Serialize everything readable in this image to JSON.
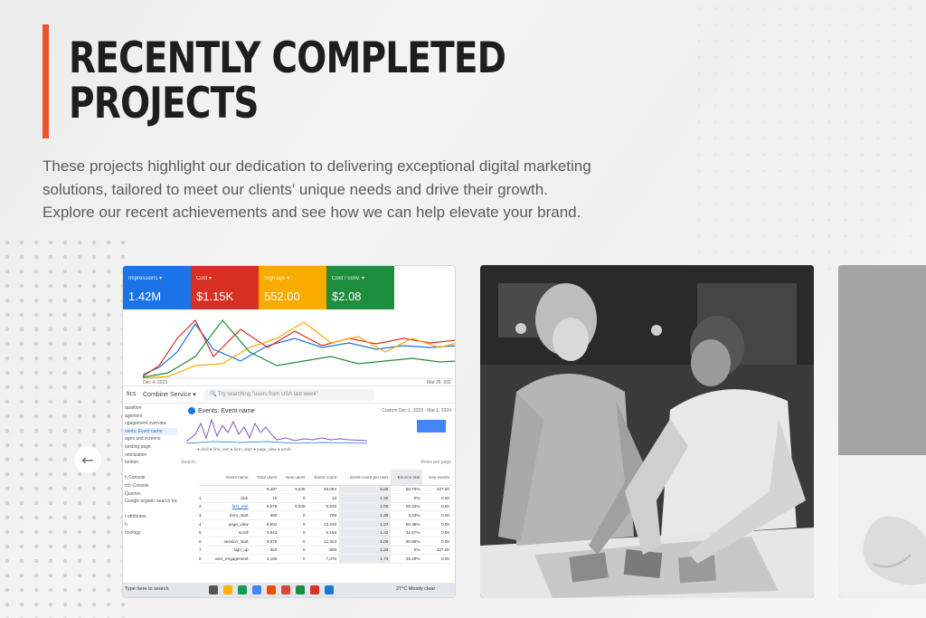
{
  "section": {
    "title_line1": "RECENTLY COMPLETED",
    "title_line2": "PROJECTS",
    "intro_line1": "These projects highlight our dedication to delivering exceptional digital marketing",
    "intro_line2": "solutions, tailored to meet our clients' unique needs and drive their growth.",
    "intro_line3": "Explore our recent achievements and see how we can help elevate your brand."
  },
  "colors": {
    "accent": "#e8542c",
    "heading": "#1e1e1e",
    "body_text": "#5a5a5a"
  },
  "carousel": {
    "prev_icon": "arrow-left-icon"
  },
  "dashboard": {
    "kpis": [
      {
        "label": "Impressions ▾",
        "value": "1.42M",
        "color": "#1a73e8"
      },
      {
        "label": "Cost ▾",
        "value": "$1.15K",
        "color": "#d93025"
      },
      {
        "label": "Sign-ups ▾",
        "value": "552.00",
        "color": "#f9ab00"
      },
      {
        "label": "Cost / conv. ▾",
        "value": "$2.08",
        "color": "#1e8e3e"
      }
    ],
    "chart_start": "Dec 4, 2023",
    "chart_end": "Mar 25, 202",
    "nav_label": "tics",
    "property": "Combine Service ▾",
    "search_placeholder": "Try searching \"users from USA last week\"",
    "events_title": "Events: Event name",
    "events_date": "Custom  Dec 1, 2023 - Mar 1, 2024",
    "legend": "● click  ● first_visit  ● form_start  ● page_view  ● scroll",
    "table_search": "Search...",
    "rows_per_page": "Rows per page",
    "sidebar": [
      "quisition",
      "agement",
      "ngagement overview",
      "vents: Event name",
      "ages and screens",
      "landing page",
      "onetization",
      "tention",
      "",
      "h Console",
      "rch Console",
      "Queries",
      "Google organic search traf...",
      "",
      "r attributes",
      "h",
      "hnology"
    ],
    "table_headers": [
      "",
      "Event name",
      "Total users",
      "New users",
      "Event count",
      "Event count per user",
      "Bounce rate",
      "Key events"
    ],
    "table_totals": [
      "",
      "",
      "9,497",
      "9,645",
      "49,094",
      "5.06",
      "60.79%",
      "427.00"
    ],
    "table_rows": [
      [
        "1",
        "click",
        "15",
        "0",
        "18",
        "1.20",
        "0%",
        "0.00"
      ],
      [
        "2",
        "first_visit",
        "9,678",
        "9,645",
        "9,645",
        "1.00",
        "59.34%",
        "0.00"
      ],
      [
        "3",
        "form_start",
        "580",
        "0",
        "798",
        "1.38",
        "3.33%",
        "0.00"
      ],
      [
        "4",
        "page_view",
        "9,692",
        "0",
        "13,249",
        "1.37",
        "60.39%",
        "0.00"
      ],
      [
        "5",
        "scroll",
        "3,642",
        "0",
        "5,158",
        "1.42",
        "31.67%",
        "0.00"
      ],
      [
        "6",
        "session_start",
        "9,676",
        "0",
        "12,303",
        "1.09",
        "60.66%",
        "0.00"
      ],
      [
        "7",
        "sign_up",
        "350",
        "0",
        "659",
        "1.93",
        "0%",
        "427.00"
      ],
      [
        "8",
        "user_engagement",
        "4,108",
        "0",
        "7,076",
        "1.73",
        "28.29%",
        "0.00"
      ]
    ],
    "taskbar_search": "Type here to search",
    "weather": "27°C  Mostly clear"
  }
}
